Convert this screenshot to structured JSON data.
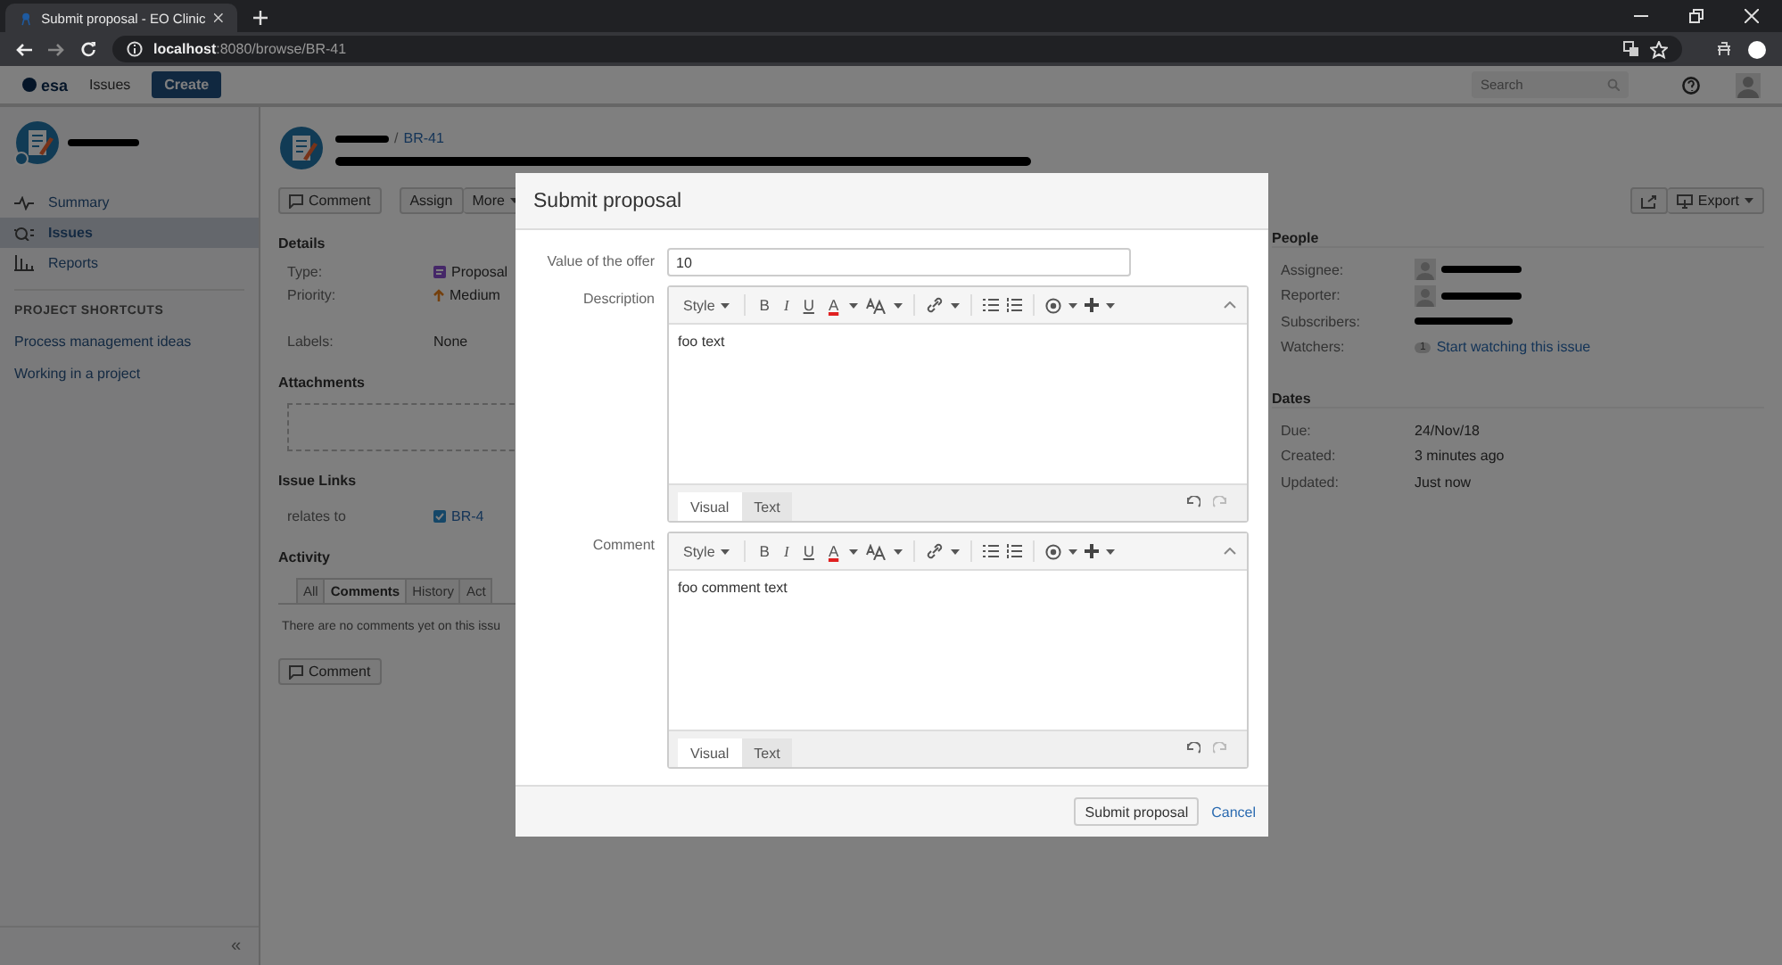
{
  "browser": {
    "tab_title": "Submit proposal - EO Clinic",
    "url_host": "localhost",
    "url_path": ":8080/browse/BR-41"
  },
  "app_header": {
    "logo": "esa",
    "nav": "Issues",
    "create": "Create",
    "search_placeholder": "Search"
  },
  "sidebar": {
    "items": [
      {
        "label": "Summary",
        "kind": "pulse",
        "selected": false
      },
      {
        "label": "Issues",
        "kind": "issues",
        "selected": true
      },
      {
        "label": "Reports",
        "kind": "bars",
        "selected": false
      }
    ],
    "section_title": "PROJECT SHORTCUTS",
    "shortcuts": [
      "Process management ideas",
      "Working in a project"
    ],
    "collapse": "«"
  },
  "issue": {
    "separator": "/",
    "key": "BR-41",
    "actions": [
      "Comment",
      "Assign",
      "More"
    ],
    "export": "Export",
    "details_title": "Details",
    "details": [
      {
        "label": "Type:",
        "value": "Proposal",
        "kind": "type"
      },
      {
        "label": "Priority:",
        "value": "Medium",
        "kind": "priority"
      },
      {
        "label": "Labels:",
        "value": "None",
        "kind": "plain"
      }
    ],
    "attachments_title": "Attachments",
    "links_title": "Issue Links",
    "link": {
      "relation": "relates to",
      "key": "BR-4"
    },
    "activity_title": "Activity",
    "activity_tabs": [
      {
        "label": "All",
        "selected": false
      },
      {
        "label": "Comments",
        "selected": true
      },
      {
        "label": "History",
        "selected": false
      },
      {
        "label": "Act",
        "selected": false
      }
    ],
    "no_comments": "There are no comments yet on this issu",
    "comment_button": "Comment",
    "people_title": "People",
    "people": [
      {
        "label": "Assignee:",
        "kind": "user"
      },
      {
        "label": "Reporter:",
        "kind": "user"
      },
      {
        "label": "Subscribers:",
        "kind": "redacted"
      },
      {
        "label": "Watchers:",
        "kind": "watch",
        "count": "1",
        "value": "Start watching this issue"
      }
    ],
    "dates_title": "Dates",
    "dates": [
      {
        "label": "Due:",
        "value": "24/Nov/18"
      },
      {
        "label": "Created:",
        "value": "3 minutes ago"
      },
      {
        "label": "Updated:",
        "value": "Just now"
      }
    ]
  },
  "dialog": {
    "title": "Submit proposal",
    "offer_label": "Value of the offer",
    "offer_value": "10",
    "editors": [
      {
        "label": "Description",
        "value": "foo text",
        "style": "Style",
        "format": [
          "B",
          "I",
          "U",
          "A"
        ],
        "tabs": [
          {
            "label": "Visual",
            "selected": true
          },
          {
            "label": "Text",
            "selected": false
          }
        ]
      },
      {
        "label": "Comment",
        "value": "foo comment text",
        "style": "Style",
        "format": [
          "B",
          "I",
          "U",
          "A"
        ],
        "tabs": [
          {
            "label": "Visual",
            "selected": true
          },
          {
            "label": "Text",
            "selected": false
          }
        ]
      }
    ],
    "submit": "Submit proposal",
    "cancel": "Cancel"
  }
}
